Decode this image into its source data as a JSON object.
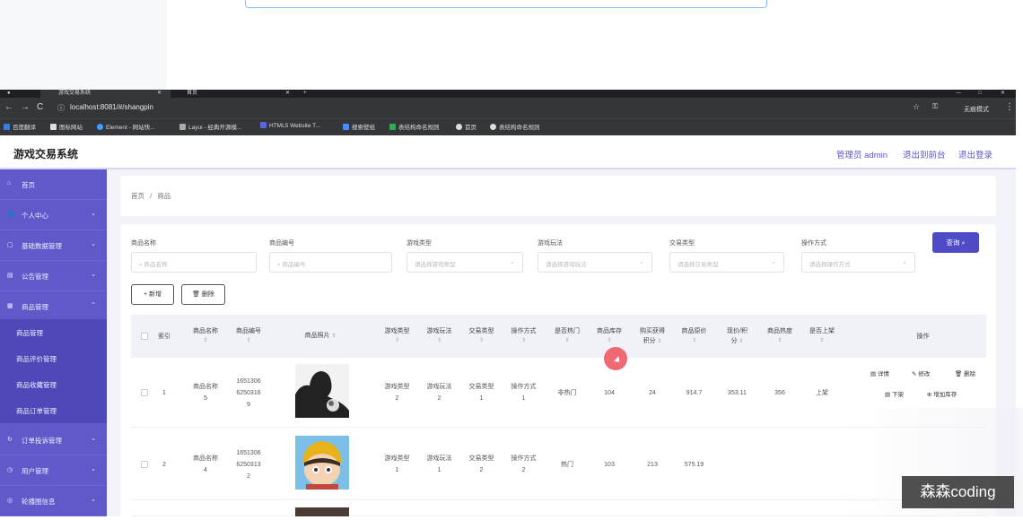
{
  "browser": {
    "tabs": [
      "游戏交易系统",
      "首页"
    ],
    "url": "localhost:8081/#/shangpin",
    "profile": "无痕模式",
    "bookmarks": [
      "百度翻译",
      "图标网站",
      "Element - 网站快...",
      "Layui - 经典开源模...",
      "HTML5 Website T...",
      "搜索壁纸",
      "表结构命名规则",
      "首页",
      "表结构命名规则"
    ]
  },
  "header": {
    "title": "游戏交易系统",
    "links": [
      "管理员 admin",
      "退出到前台",
      "退出登录"
    ]
  },
  "sidebar": {
    "items": [
      {
        "label": "首页",
        "icon": "home-icon",
        "chevron": false
      },
      {
        "label": "个人中心",
        "icon": "user-icon",
        "chevron": true
      },
      {
        "label": "基础数据管理",
        "icon": "database-icon",
        "chevron": true
      },
      {
        "label": "公告管理",
        "icon": "notice-icon",
        "chevron": true
      },
      {
        "label": "商品管理",
        "icon": "goods-icon",
        "chevron": true
      }
    ],
    "sub_items": [
      "商品管理",
      "商品评价管理",
      "商品收藏管理",
      "商品订单管理"
    ],
    "bottom_items": [
      {
        "label": "订单投诉管理",
        "icon": "complaint-icon"
      },
      {
        "label": "用户管理",
        "icon": "users-icon"
      },
      {
        "label": "轮播图信息",
        "icon": "carousel-icon"
      }
    ]
  },
  "breadcrumb": {
    "home": "首页",
    "sep": "/",
    "current": "商品"
  },
  "filters": [
    {
      "label": "商品名称",
      "placeholder": "商品名称",
      "type": "input"
    },
    {
      "label": "商品编号",
      "placeholder": "商品编号",
      "type": "input"
    },
    {
      "label": "游戏类型",
      "placeholder": "请选择游戏类型",
      "type": "select"
    },
    {
      "label": "游戏玩法",
      "placeholder": "请选择游戏玩法",
      "type": "select"
    },
    {
      "label": "交易类型",
      "placeholder": "请选择交易类型",
      "type": "select"
    },
    {
      "label": "操作方式",
      "placeholder": "请选择操作方式",
      "type": "select"
    }
  ],
  "buttons": {
    "query": "查询",
    "add": "新增",
    "delete": "删除"
  },
  "table": {
    "headers": [
      {
        "l1": "索引",
        "l2": "",
        "sort": false
      },
      {
        "l1": "商品名称",
        "l2": "",
        "sort": true
      },
      {
        "l1": "商品编号",
        "l2": "",
        "sort": true
      },
      {
        "l1": "商品照片",
        "l2": "",
        "sort": true
      },
      {
        "l1": "游戏类型",
        "l2": "",
        "sort": true
      },
      {
        "l1": "游戏玩法",
        "l2": "",
        "sort": true
      },
      {
        "l1": "交易类型",
        "l2": "",
        "sort": true
      },
      {
        "l1": "操作方式",
        "l2": "",
        "sort": true
      },
      {
        "l1": "是否热门",
        "l2": "",
        "sort": true
      },
      {
        "l1": "商品库存",
        "l2": "",
        "sort": true
      },
      {
        "l1": "购买获得",
        "l2": "积分",
        "sort": true
      },
      {
        "l1": "商品原价",
        "l2": "",
        "sort": true
      },
      {
        "l1": "现价/积",
        "l2": "分",
        "sort": true
      },
      {
        "l1": "商品热度",
        "l2": "",
        "sort": true
      },
      {
        "l1": "是否上架",
        "l2": "",
        "sort": true
      },
      {
        "l1": "操作",
        "l2": "",
        "sort": false
      }
    ],
    "rows": [
      {
        "index": "1",
        "name": [
          "商品名称",
          "5"
        ],
        "code": [
          "1651306",
          "6250316",
          "9"
        ],
        "gtype": [
          "游戏类型",
          "2"
        ],
        "play": [
          "游戏玩法",
          "2"
        ],
        "trade": [
          "交易类型",
          "1"
        ],
        "op": [
          "操作方式",
          "1"
        ],
        "hot": "非热门",
        "stock": "104",
        "points": "24",
        "orig": "914.7",
        "price": "353.11",
        "heat": "356",
        "shelf": "上架"
      },
      {
        "index": "2",
        "name": [
          "商品名称",
          "4"
        ],
        "code": [
          "1651306",
          "6250313",
          "2"
        ],
        "gtype": [
          "游戏类型",
          "1"
        ],
        "play": [
          "游戏玩法",
          "1"
        ],
        "trade": [
          "交易类型",
          "2"
        ],
        "op": [
          "操作方式",
          "2"
        ],
        "hot": "热门",
        "stock": "103",
        "points": "213",
        "orig": "575.19",
        "price": "",
        "heat": "",
        "shelf": ""
      }
    ],
    "actions": [
      "详情",
      "修改",
      "删除",
      "下架",
      "增加库存"
    ]
  },
  "watermark": "森森coding",
  "colors": {
    "sidebar": "#5f59c9",
    "accent": "#4f4ac6",
    "link": "#5a57c9",
    "cursor": "#ee5a66"
  }
}
